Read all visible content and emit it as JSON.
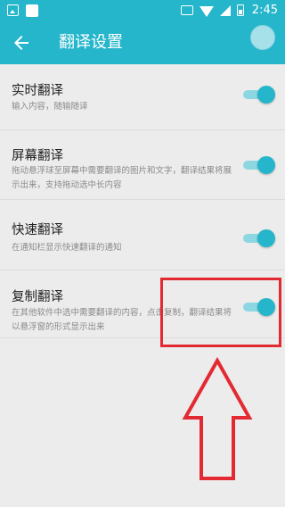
{
  "status_bar": {
    "time": "2:45"
  },
  "app_bar": {
    "title": "翻译设置"
  },
  "items": [
    {
      "title": "实时翻译",
      "subtitle": "输入内容，随输随译",
      "enabled": true
    },
    {
      "title": "屏幕翻译",
      "subtitle": "拖动悬浮球至屏幕中需要翻译的图片和文字，翻译结果将展示出来，支持拖动选中长内容",
      "enabled": true
    },
    {
      "title": "快速翻译",
      "subtitle": "在通知栏显示快速翻译的通知",
      "enabled": true
    },
    {
      "title": "复制翻译",
      "subtitle": "在其他软件中选中需要翻译的内容，点击复制，翻译结果将以悬浮窗的形式显示出来",
      "enabled": true
    }
  ],
  "colors": {
    "accent": "#26b6cb",
    "toggle_track": "#8cd7e2",
    "annotation": "#e32a32",
    "background": "#ececec"
  }
}
